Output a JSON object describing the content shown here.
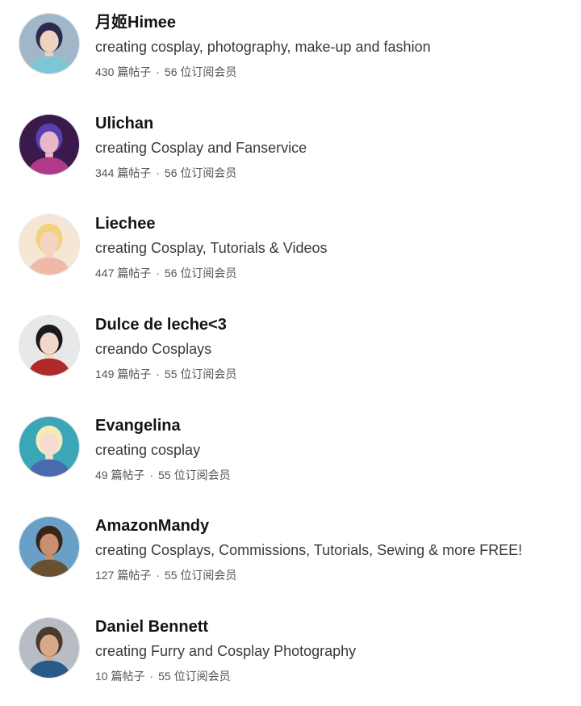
{
  "creators": [
    {
      "name": "月姬Himee",
      "tagline": "creating cosplay, photography, make-up and fashion",
      "posts": "430 篇帖子",
      "members": "56 位订阅会员",
      "avatar": {
        "bg": "#9fb7c9",
        "skin": "#f0d2c0",
        "hair": "#2b2b4a",
        "outfit": "#7ec6d6"
      }
    },
    {
      "name": "Ulichan",
      "tagline": "creating Cosplay and Fanservice",
      "posts": "344 篇帖子",
      "members": "56 位订阅会员",
      "avatar": {
        "bg": "#3a1a4a",
        "skin": "#e8b8c8",
        "hair": "#5a3fb0",
        "outfit": "#b03a8a"
      }
    },
    {
      "name": "Liechee",
      "tagline": "creating Cosplay, Tutorials & Videos",
      "posts": "447 篇帖子",
      "members": "56 位订阅会员",
      "avatar": {
        "bg": "#f5e6d6",
        "skin": "#f6d4c2",
        "hair": "#f2d27a",
        "outfit": "#f0b8a8"
      }
    },
    {
      "name": "Dulce de leche<3",
      "tagline": "creando Cosplays",
      "posts": "149 篇帖子",
      "members": "55 位订阅会员",
      "avatar": {
        "bg": "#e8e8e8",
        "skin": "#f2d8c8",
        "hair": "#1a1a1a",
        "outfit": "#b02a2a"
      }
    },
    {
      "name": "Evangelina",
      "tagline": "creating cosplay",
      "posts": "49 篇帖子",
      "members": "55 位订阅会员",
      "avatar": {
        "bg": "#3aa6b8",
        "skin": "#f4dcd0",
        "hair": "#f6eab8",
        "outfit": "#4a6ab0"
      }
    },
    {
      "name": "AmazonMandy",
      "tagline": "creating Cosplays, Commissions, Tutorials, Sewing & more FREE!",
      "posts": "127 篇帖子",
      "members": "55 位订阅会员",
      "avatar": {
        "bg": "#6aa0c8",
        "skin": "#c89070",
        "hair": "#3a2418",
        "outfit": "#6a5030"
      }
    },
    {
      "name": "Daniel Bennett",
      "tagline": "creating Furry and Cosplay Photography",
      "posts": "10 篇帖子",
      "members": "55 位订阅会员",
      "avatar": {
        "bg": "#b8bcc4",
        "skin": "#d8a888",
        "hair": "#4a3a2a",
        "outfit": "#2a5a8a"
      }
    }
  ]
}
